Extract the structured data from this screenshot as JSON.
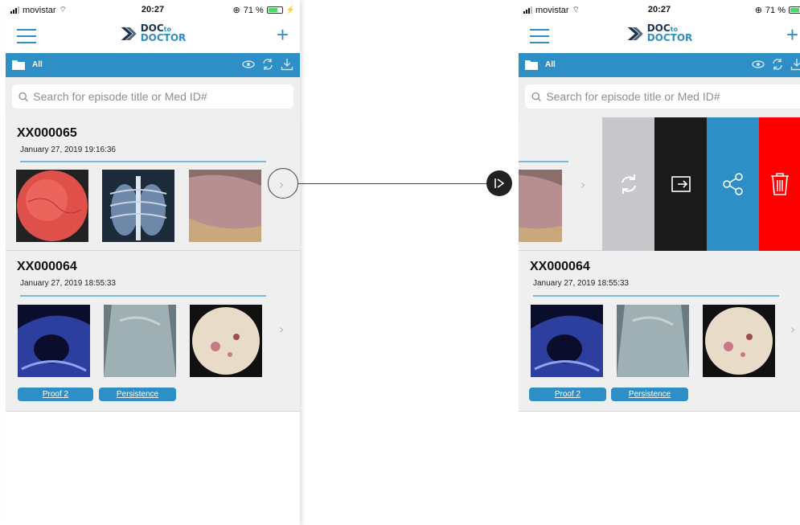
{
  "status": {
    "carrier": "movistar",
    "time": "20:27",
    "battery": "71 %"
  },
  "app": {
    "logo_top": "DOC",
    "logo_to": "to",
    "logo_bottom": "DOCTOR"
  },
  "folder": {
    "label": "All"
  },
  "search": {
    "placeholder": "Search for episode title or Med ID#"
  },
  "episodes": [
    {
      "id": "XX000065",
      "date": "January 27, 2019 19:16:36"
    },
    {
      "id": "XX000064",
      "date": "January 27, 2019 18:55:33",
      "tags": [
        "Proof 2",
        "Persistence"
      ]
    }
  ],
  "swipe_actions": [
    "refresh",
    "export",
    "share",
    "delete"
  ],
  "colors": {
    "primary": "#2e8fc6",
    "refresh_bg": "#c7c7cc",
    "export_bg": "#1a1a1a",
    "share_bg": "#2e8fc6",
    "delete_bg": "#ff0000"
  }
}
